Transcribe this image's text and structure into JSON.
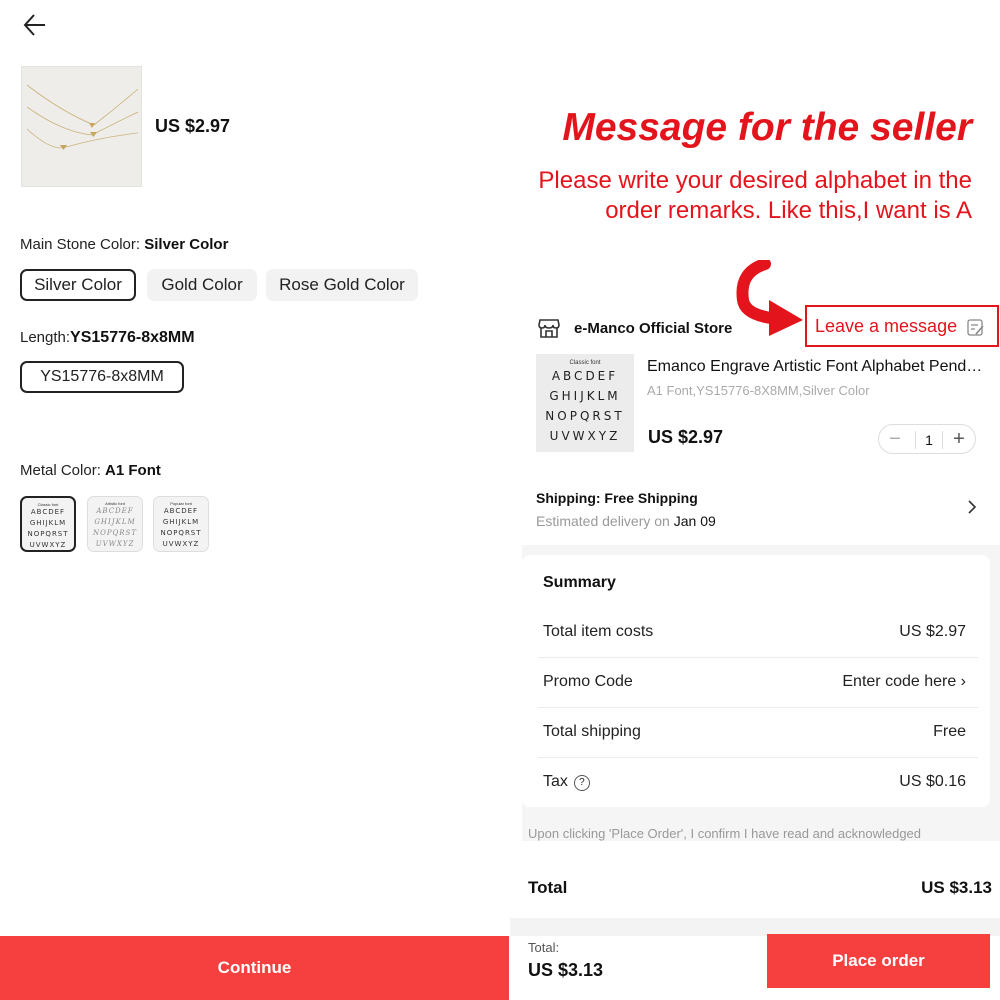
{
  "colors": {
    "accent_red": "#f5403f",
    "annotation_red": "#e4141c"
  },
  "left": {
    "price": "US $2.97",
    "main_stone": {
      "label": "Main Stone Color: ",
      "value": "Silver Color",
      "options": [
        "Silver Color",
        "Gold Color",
        "Rose Gold Color"
      ],
      "selected": "Silver Color"
    },
    "length": {
      "label": "Length:",
      "value": "YS15776-8x8MM",
      "options": [
        "YS15776-8x8MM"
      ],
      "selected": "YS15776-8x8MM"
    },
    "metal": {
      "label": "Metal Color: ",
      "value": "A1 Font",
      "swatches": [
        {
          "title": "Classic font",
          "rows": [
            "ABCDEF",
            "GHIJKLM",
            "NOPQRST",
            "UVWXYZ"
          ]
        },
        {
          "title": "Artistic font",
          "rows": [
            "ABCDEF",
            "GHIJKLM",
            "NOPQRST",
            "UVWXYZ"
          ]
        },
        {
          "title": "Popular font",
          "rows": [
            "ABCDEF",
            "GHIJKLM",
            "NOPQRST",
            "UVWXYZ"
          ]
        }
      ]
    },
    "continue_label": "Continue"
  },
  "right": {
    "annotation_title": "Message for the seller",
    "annotation_sub": "Please write your desired alphabet in the order remarks. Like this,I want is A",
    "store_name": "e-Manco Official Store",
    "leave_message": "Leave a message",
    "product": {
      "img_title": "Classic font",
      "img_rows": [
        "ABCDEF",
        "GHIJKLM",
        "NOPQRST",
        "UVWXYZ"
      ],
      "name": "Emanco Engrave Artistic Font Alphabet Pendant Necklace",
      "variant": "A1 Font,YS15776-8X8MM,Silver Color",
      "price": "US $2.97",
      "quantity": "1"
    },
    "shipping": {
      "title": "Shipping: Free Shipping",
      "estimate_prefix": "Estimated delivery on ",
      "date": "Jan 09"
    },
    "summary": {
      "title": "Summary",
      "rows": [
        {
          "label": "Total item costs",
          "value": "US $2.97"
        },
        {
          "label": "Promo Code",
          "value": "Enter code here ›"
        },
        {
          "label": "Total shipping",
          "value": "Free"
        },
        {
          "label": "Tax",
          "value": "US $0.16"
        }
      ]
    },
    "disclaimer": "Upon clicking 'Place Order', I confirm I have read and acknowledged",
    "total_label": "Total",
    "total_value": "US $3.13",
    "bottom_total_label": "Total:",
    "bottom_total_value": "US $3.13",
    "place_order_label": "Place order"
  }
}
